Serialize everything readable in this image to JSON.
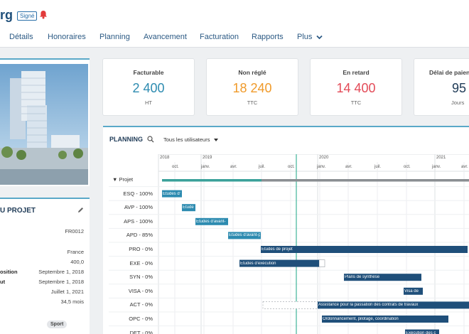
{
  "header": {
    "title": "rg",
    "badge": "Signé",
    "nav": [
      "Détails",
      "Honoraires",
      "Planning",
      "Avancement",
      "Facturation",
      "Rapports",
      "Plus"
    ]
  },
  "project_info": {
    "title": "U PROJET",
    "values": [
      "FR0012",
      "France",
      "400,0",
      "Septembre 1, 2018",
      "Septembre 1, 2018",
      "Juillet 1, 2021",
      "34,5 mois"
    ],
    "labels": [
      "osition",
      "ut"
    ],
    "tag": "Sport"
  },
  "kpis": [
    {
      "label": "Facturable",
      "value": "2 400",
      "unit": "HT",
      "color": "#2d8bb0"
    },
    {
      "label": "Non réglé",
      "value": "18 240",
      "unit": "TTC",
      "color": "#f09a2a"
    },
    {
      "label": "En retard",
      "value": "14 400",
      "unit": "TTC",
      "color": "#e34b58"
    },
    {
      "label": "Délai de paien",
      "value": "95",
      "unit": "Jours",
      "color": "#1f3b57"
    }
  ],
  "planning": {
    "title": "PLANNING",
    "users_filter": "Tous les utilisateurs",
    "years": [
      "2018",
      "2019",
      "2020",
      "2021"
    ],
    "months": [
      "oct.",
      "janv.",
      "avr.",
      "juil.",
      "oct.",
      "janv.",
      "avr.",
      "juil.",
      "oct.",
      "janv.",
      "avr."
    ],
    "project_row": "Projet",
    "rows": [
      {
        "label": "ESQ - 100%",
        "bar": "Études d'",
        "color": "#2d8bb0"
      },
      {
        "label": "AVP - 100%",
        "bar": "Étude",
        "color": "#2d8bb0"
      },
      {
        "label": "APS - 100%",
        "bar": "Études d'avant-",
        "color": "#2d8bb0"
      },
      {
        "label": "APD - 85%",
        "bar": "Études d'avant-p",
        "color": "#2d8bb0"
      },
      {
        "label": "PRO - 0%",
        "bar": "Études de projet",
        "color": "#1f4f7a"
      },
      {
        "label": "EXE - 0%",
        "bar": "Études d'exécution",
        "color": "#1f4f7a"
      },
      {
        "label": "SYN - 0%",
        "bar": "Plans de synthèse",
        "color": "#1f4f7a"
      },
      {
        "label": "VISA - 0%",
        "bar": "Visa de",
        "color": "#1f4f7a"
      },
      {
        "label": "ACT - 0%",
        "bar": "Assistance pour la passation des contrats de travaux",
        "color": "#1f4f7a"
      },
      {
        "label": "OPC - 0%",
        "bar": "Ordonnancement, pilotage, coordination",
        "color": "#1f4f7a"
      },
      {
        "label": "DET - 0%",
        "bar": "Exécution des c",
        "color": "#1f4f7a"
      }
    ]
  }
}
